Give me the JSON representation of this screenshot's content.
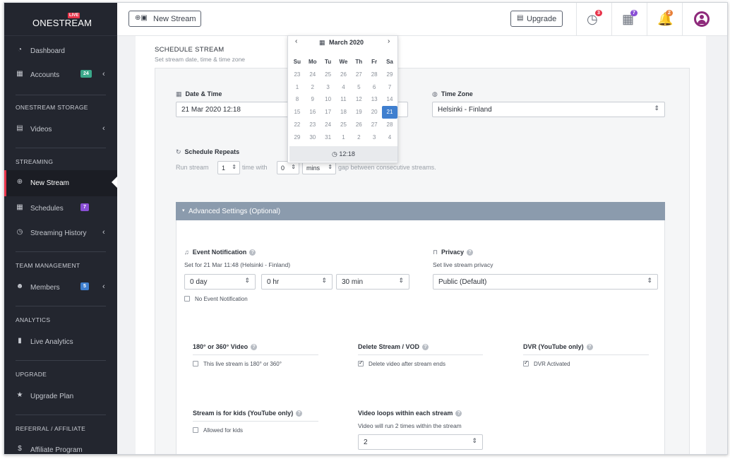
{
  "app": {
    "logo_text": "ONESTREAM",
    "logo_badge": "LIVE"
  },
  "sidebar": {
    "items": [
      {
        "label": "Dashboard",
        "icon": "dashboard-icon"
      },
      {
        "label": "Accounts",
        "icon": "grid-icon",
        "badge": "24",
        "badge_color": "#3aa88a"
      },
      {
        "label": "Videos",
        "icon": "film-icon"
      },
      {
        "label": "New Stream",
        "icon": "plus-circle-icon"
      },
      {
        "label": "Schedules",
        "icon": "calendar-icon",
        "badge": "7",
        "badge_color": "#8a4fd6"
      },
      {
        "label": "Streaming History",
        "icon": "history-icon"
      },
      {
        "label": "Members",
        "icon": "users-icon",
        "badge": "5",
        "badge_color": "#3f7fcf"
      },
      {
        "label": "Live Analytics",
        "icon": "bar-chart-icon"
      },
      {
        "label": "Upgrade Plan",
        "icon": "star-icon"
      },
      {
        "label": "Affiliate Program",
        "icon": "dollar-icon"
      }
    ],
    "sections": {
      "storage": "ONESTREAM STORAGE",
      "streaming": "STREAMING",
      "team": "TEAM MANAGEMENT",
      "analytics": "ANALYTICS",
      "upgrade": "UPGRADE",
      "referral": "REFERRAL / AFFILIATE"
    }
  },
  "topbar": {
    "new_stream_label": "New Stream",
    "upgrade_label": "Upgrade",
    "badges": {
      "streams": "3",
      "schedules": "7",
      "notifications": "2"
    },
    "badge_colors": {
      "streams": "#e8344a",
      "schedules": "#8a4fd6",
      "notifications": "#e8803a"
    }
  },
  "form": {
    "title": "SCHEDULE STREAM",
    "subtitle": "Set stream date, time & time zone",
    "date_time_label": "Date & Time",
    "date_time_value": "21 Mar 2020 12:18",
    "time_zone_label": "Time Zone",
    "time_zone_value": "Helsinki - Finland",
    "schedule_repeats_label": "Schedule Repeats",
    "repeat_prefix": "Run stream",
    "repeat_count": "1",
    "repeat_mid": "time with",
    "repeat_gap": "0",
    "repeat_unit": "mins",
    "repeat_suffix": "gap between consecutive streams."
  },
  "calendar": {
    "month": "March 2020",
    "days_of_week": [
      "Su",
      "Mo",
      "Tu",
      "We",
      "Th",
      "Fr",
      "Sa"
    ],
    "weeks": [
      [
        "23",
        "24",
        "25",
        "26",
        "27",
        "28",
        "29"
      ],
      [
        "1",
        "2",
        "3",
        "4",
        "5",
        "6",
        "7"
      ],
      [
        "8",
        "9",
        "10",
        "11",
        "12",
        "13",
        "14"
      ],
      [
        "15",
        "16",
        "17",
        "18",
        "19",
        "20",
        "21"
      ],
      [
        "22",
        "23",
        "24",
        "25",
        "26",
        "27",
        "28"
      ],
      [
        "29",
        "30",
        "31",
        "1",
        "2",
        "3",
        "4"
      ]
    ],
    "selected": "21",
    "time": "12:18"
  },
  "advanced": {
    "header": "Advanced Settings (Optional)",
    "event_notification_label": "Event Notification",
    "event_notification_desc": "Set for 21 Mar 11:48 (Helsinki - Finland)",
    "day_value": "0 day",
    "hr_value": "0 hr",
    "min_value": "30 min",
    "no_event_notification": "No Event Notification",
    "privacy_label": "Privacy",
    "privacy_desc": "Set live stream privacy",
    "privacy_value": "Public (Default)",
    "video360_label": "180° or 360° Video",
    "video360_check": "This live stream is 180° or 360°",
    "delete_label": "Delete Stream / VOD",
    "delete_check": "Delete video after stream ends",
    "dvr_label": "DVR (YouTube only)",
    "dvr_check": "DVR Activated",
    "kids_label": "Stream is for kids (YouTube only)",
    "kids_check": "Allowed for kids",
    "loops_label": "Video loops within each stream",
    "loops_desc": "Video will run 2 times within the stream",
    "loops_value": "2"
  }
}
